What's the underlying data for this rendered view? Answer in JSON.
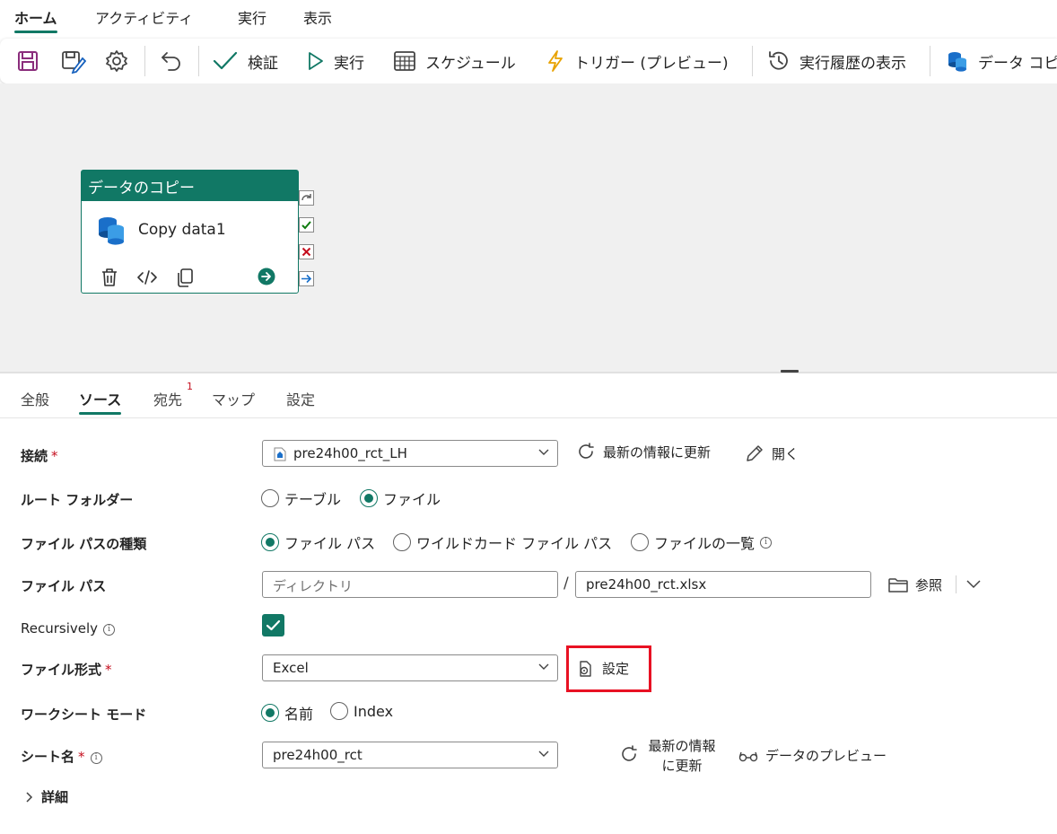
{
  "topnav": {
    "tabs": [
      "ホーム",
      "アクティビティ",
      "実行",
      "表示"
    ],
    "active": "ホーム"
  },
  "toolbar": {
    "validate": "検証",
    "run": "実行",
    "schedule": "スケジュール",
    "trigger": "トリガー (プレビュー)",
    "history": "実行履歴の表示",
    "copy_data": "データ コピー"
  },
  "node": {
    "header": "データのコピー",
    "name": "Copy data1"
  },
  "panel": {
    "tabs": [
      "全般",
      "ソース",
      "宛先",
      "マップ",
      "設定"
    ],
    "active_tab": "ソース",
    "dest_badge": "1"
  },
  "form": {
    "connection": {
      "label": "接続",
      "required": "*",
      "value": "pre24h00_rct_LH",
      "refresh": "最新の情報に更新",
      "open": "開く"
    },
    "root_folder": {
      "label": "ルート フォルダー",
      "options": [
        "テーブル",
        "ファイル"
      ],
      "selected": "ファイル"
    },
    "path_type": {
      "label": "ファイル パスの種類",
      "options": [
        "ファイル パス",
        "ワイルドカード ファイル パス",
        "ファイルの一覧"
      ],
      "selected": "ファイル パス",
      "info": "i"
    },
    "file_path": {
      "label": "ファイル パス",
      "dir_placeholder": "ディレクトリ",
      "separator": "/",
      "file": "pre24h00_rct.xlsx",
      "browse": "参照"
    },
    "recursively": {
      "label": "Recursively",
      "checked": true,
      "info": "i"
    },
    "file_format": {
      "label": "ファイル形式",
      "required": "*",
      "value": "Excel",
      "settings": "設定"
    },
    "worksheet_mode": {
      "label": "ワークシート モード",
      "options": [
        "名前",
        "Index"
      ],
      "selected": "名前"
    },
    "sheet_name": {
      "label": "シート名",
      "required": "*",
      "info": "i",
      "value": "pre24h00_rct",
      "refresh_line1": "最新の情報",
      "refresh_line2": "に更新",
      "preview": "データのプレビュー"
    },
    "details": "詳細"
  },
  "colors": {
    "accent": "#117865",
    "highlight": "#e81123",
    "required": "#c50f1f"
  }
}
